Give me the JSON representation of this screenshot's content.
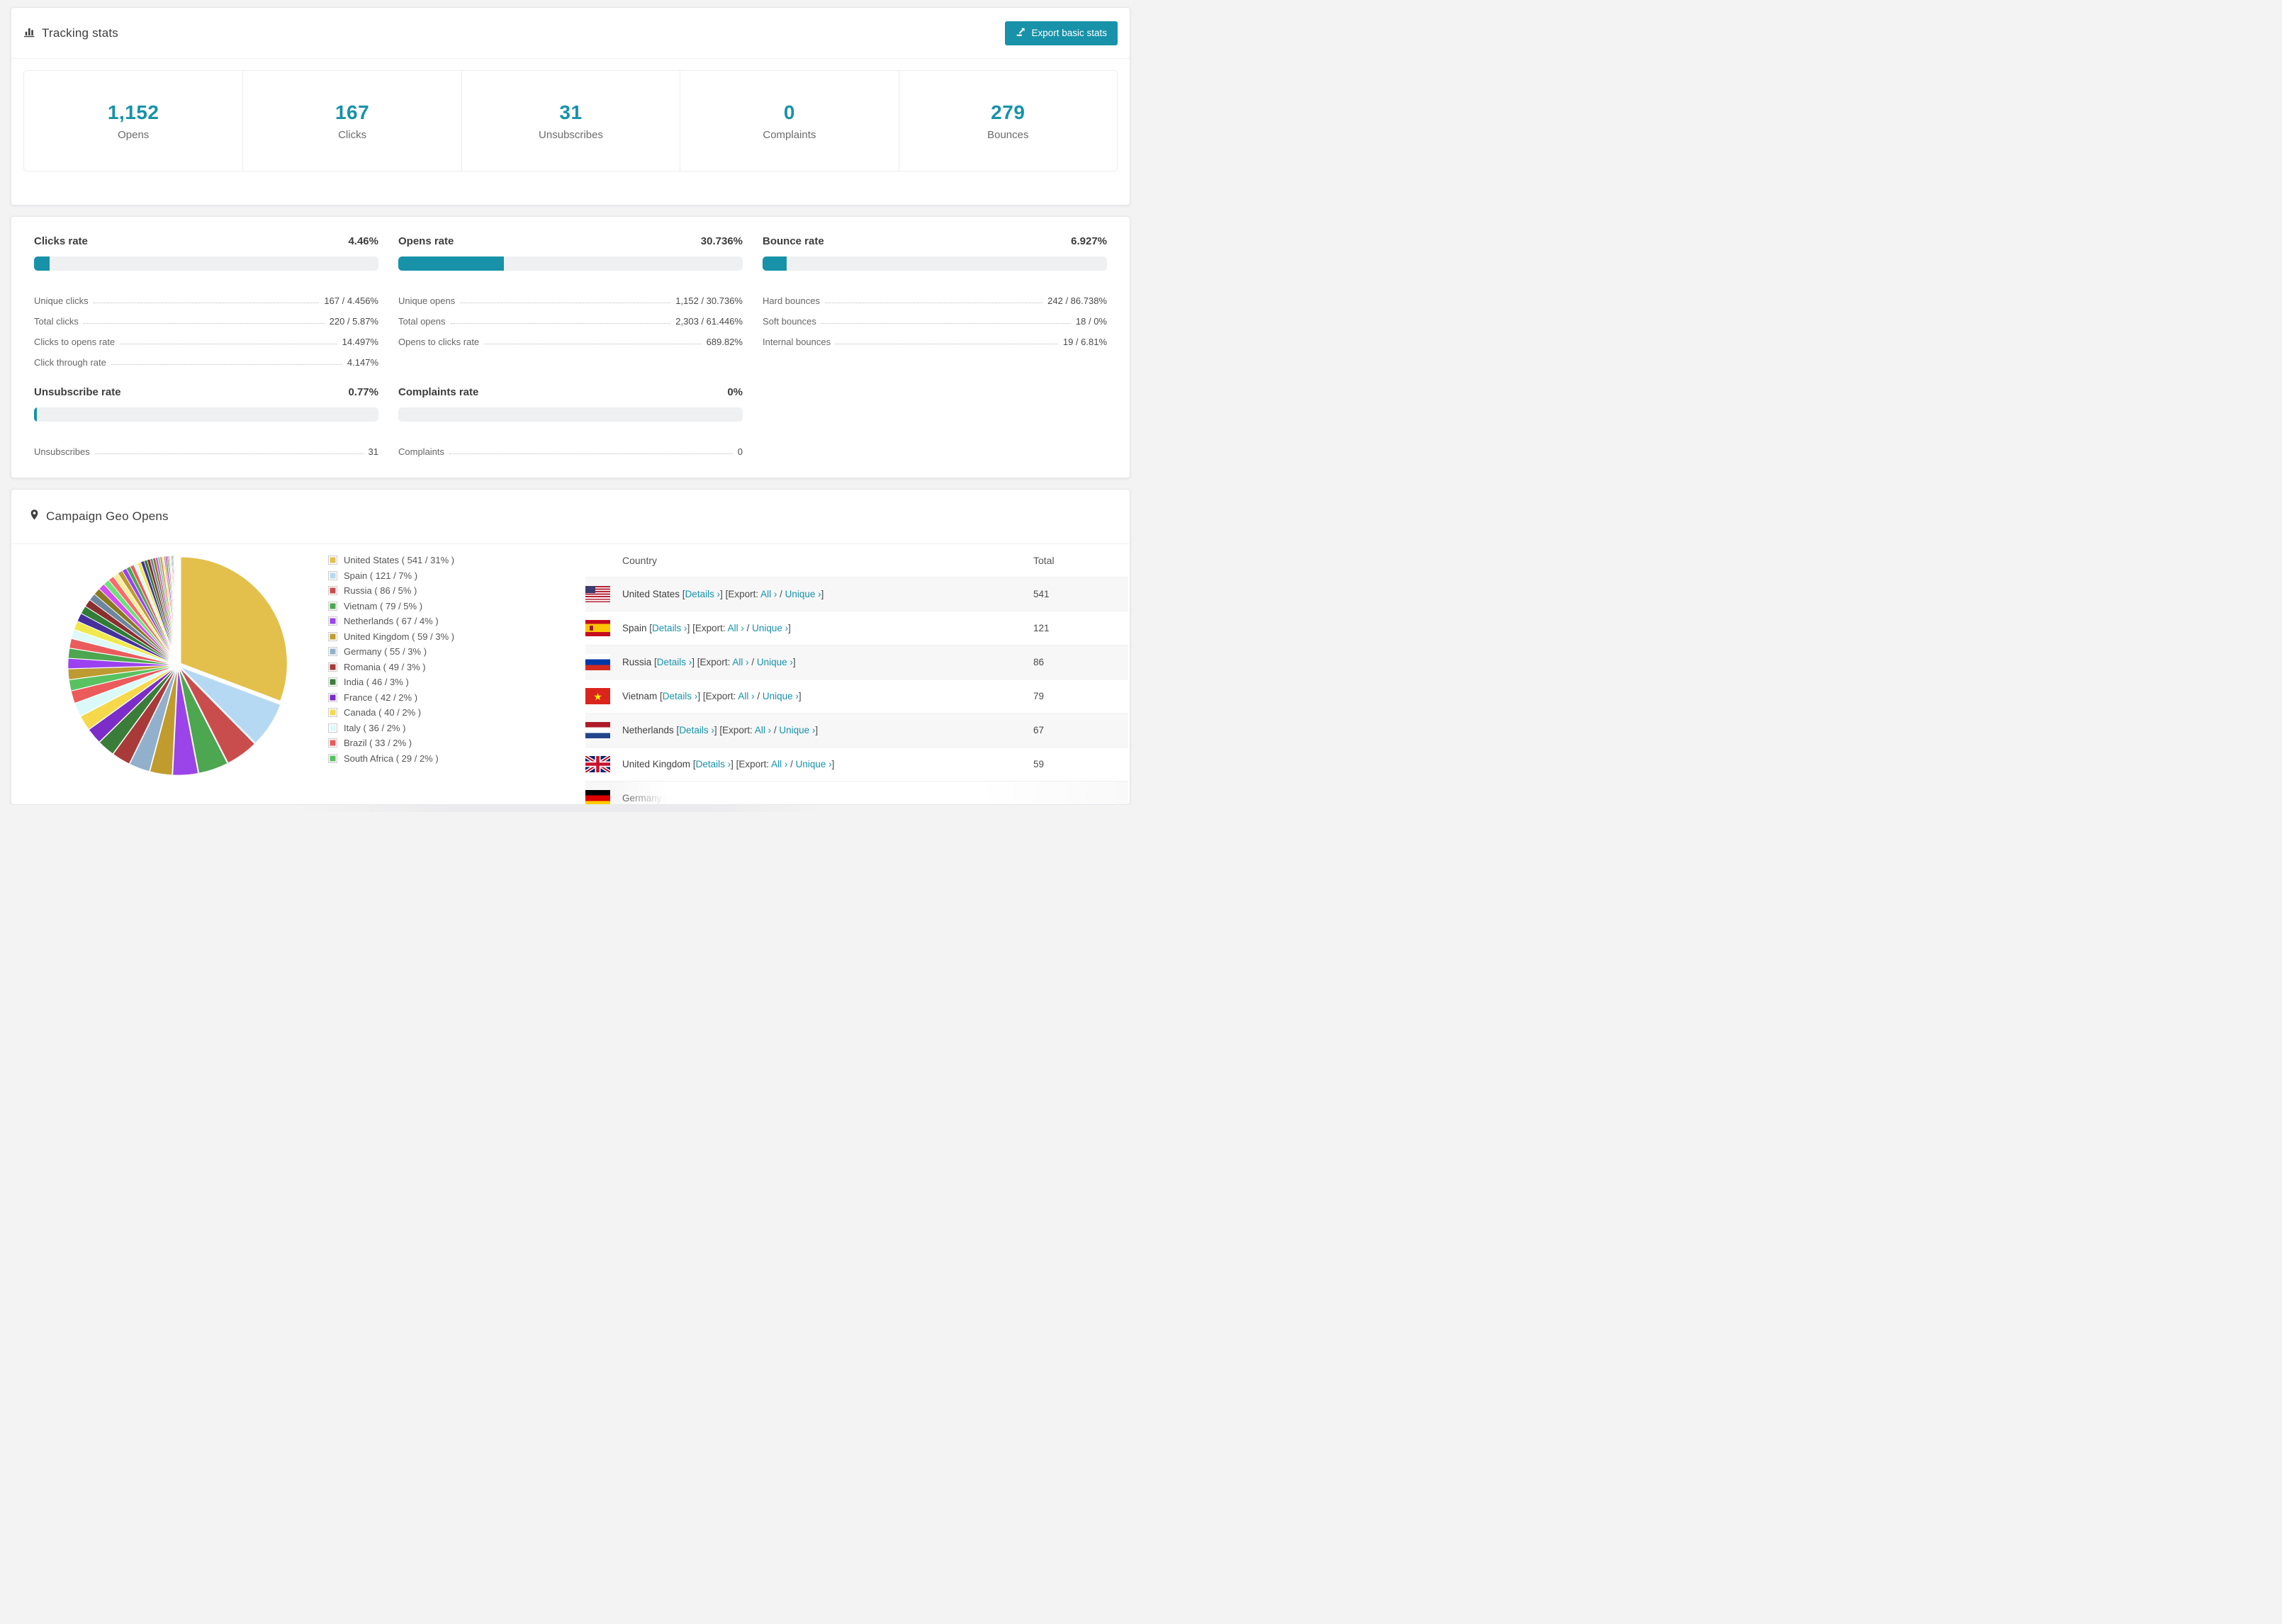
{
  "accent_color": "#1792a9",
  "header": {
    "title": "Tracking stats",
    "export_label": "Export basic stats"
  },
  "summary_stats": [
    {
      "value": "1,152",
      "label": "Opens"
    },
    {
      "value": "167",
      "label": "Clicks"
    },
    {
      "value": "31",
      "label": "Unsubscribes"
    },
    {
      "value": "0",
      "label": "Complaints"
    },
    {
      "value": "279",
      "label": "Bounces"
    }
  ],
  "rates": [
    {
      "title": "Clicks rate",
      "value": "4.46%",
      "progress_pct": 4.46,
      "rows": [
        [
          "Unique clicks",
          "167 / 4.456%"
        ],
        [
          "Total clicks",
          "220 / 5.87%"
        ],
        [
          "Clicks to opens rate",
          "14.497%"
        ],
        [
          "Click through rate",
          "4.147%"
        ]
      ]
    },
    {
      "title": "Opens rate",
      "value": "30.736%",
      "progress_pct": 30.736,
      "rows": [
        [
          "Unique opens",
          "1,152 / 30.736%"
        ],
        [
          "Total opens",
          "2,303 / 61.446%"
        ],
        [
          "Opens to clicks rate",
          "689.82%"
        ]
      ]
    },
    {
      "title": "Bounce rate",
      "value": "6.927%",
      "progress_pct": 6.927,
      "rows": [
        [
          "Hard bounces",
          "242 / 86.738%"
        ],
        [
          "Soft bounces",
          "18 / 0%"
        ],
        [
          "Internal bounces",
          "19 / 6.81%"
        ]
      ]
    },
    {
      "title": "Unsubscribe rate",
      "value": "0.77%",
      "progress_pct": 0.77,
      "rows": [
        [
          "Unsubscribes",
          "31"
        ]
      ]
    },
    {
      "title": "Complaints rate",
      "value": "0%",
      "progress_pct": 0,
      "rows": [
        [
          "Complaints",
          "0"
        ]
      ]
    }
  ],
  "geo": {
    "title": "Campaign Geo Opens",
    "legend": [
      {
        "label": "United States ( 541 / 31% )",
        "color": "#e3c04b"
      },
      {
        "label": "Spain ( 121 / 7% )",
        "color": "#b5d9f3"
      },
      {
        "label": "Russia ( 86 / 5% )",
        "color": "#ca4d4d"
      },
      {
        "label": "Vietnam ( 79 / 5% )",
        "color": "#4ca750"
      },
      {
        "label": "Netherlands ( 67 / 4% )",
        "color": "#9b44ea"
      },
      {
        "label": "United Kingdom ( 59 / 3% )",
        "color": "#c09c2e"
      },
      {
        "label": "Germany ( 55 / 3% )",
        "color": "#92b0cc"
      },
      {
        "label": "Romania ( 49 / 3% )",
        "color": "#a83a3a"
      },
      {
        "label": "India ( 46 / 3% )",
        "color": "#3a7d3a"
      },
      {
        "label": "France ( 42 / 2% )",
        "color": "#7b2cc9"
      },
      {
        "label": "Canada ( 40 / 2% )",
        "color": "#f5d94b"
      },
      {
        "label": "Italy ( 36 / 2% )",
        "color": "#dbf9f9"
      },
      {
        "label": "Brazil ( 33 / 2% )",
        "color": "#eb5b5b"
      },
      {
        "label": "South Africa ( 29 / 2% )",
        "color": "#58c261"
      }
    ],
    "table": {
      "columns": [
        "Country",
        "Total"
      ],
      "link_labels": {
        "details": "Details ›",
        "export_prefix": "Export:",
        "all": "All ›",
        "unique": "Unique ›"
      },
      "rows": [
        {
          "flag": "us",
          "country": "United States",
          "total": "541",
          "partial": false
        },
        {
          "flag": "es",
          "country": "Spain",
          "total": "121",
          "partial": false
        },
        {
          "flag": "ru",
          "country": "Russia",
          "total": "86",
          "partial": false
        },
        {
          "flag": "vn",
          "country": "Vietnam",
          "total": "79",
          "partial": false
        },
        {
          "flag": "nl",
          "country": "Netherlands",
          "total": "67",
          "partial": false
        },
        {
          "flag": "gb",
          "country": "United Kingdom",
          "total": "59",
          "partial": false
        },
        {
          "flag": "de",
          "country": "Germany",
          "total": "",
          "partial": true
        }
      ]
    }
  },
  "chart_data": {
    "type": "pie",
    "title": "Campaign Geo Opens",
    "legend_position": "right",
    "start_angle_deg": -90,
    "direction": "clockwise",
    "series": [
      {
        "name": "United States",
        "value": 541,
        "pct": "31%",
        "color": "#e3c04b"
      },
      {
        "name": "Spain",
        "value": 121,
        "pct": "7%",
        "color": "#b5d9f3"
      },
      {
        "name": "Russia",
        "value": 86,
        "pct": "5%",
        "color": "#ca4d4d"
      },
      {
        "name": "Vietnam",
        "value": 79,
        "pct": "5%",
        "color": "#4ca750"
      },
      {
        "name": "Netherlands",
        "value": 67,
        "pct": "4%",
        "color": "#9b44ea"
      },
      {
        "name": "United Kingdom",
        "value": 59,
        "pct": "3%",
        "color": "#c09c2e"
      },
      {
        "name": "Germany",
        "value": 55,
        "pct": "3%",
        "color": "#92b0cc"
      },
      {
        "name": "Romania",
        "value": 49,
        "pct": "3%",
        "color": "#a83a3a"
      },
      {
        "name": "India",
        "value": 46,
        "pct": "3%",
        "color": "#3a7d3a"
      },
      {
        "name": "France",
        "value": 42,
        "pct": "2%",
        "color": "#7b2cc9"
      },
      {
        "name": "Canada",
        "value": 40,
        "pct": "2%",
        "color": "#f5d94b"
      },
      {
        "name": "Italy",
        "value": 36,
        "pct": "2%",
        "color": "#dbf9f9"
      },
      {
        "name": "Brazil",
        "value": 33,
        "pct": "2%",
        "color": "#eb5b5b"
      },
      {
        "name": "South Africa",
        "value": 29,
        "pct": "2%",
        "color": "#58c261"
      }
    ],
    "others_estimated_values": [
      28,
      27,
      26,
      25,
      24,
      23,
      22,
      21,
      20,
      19,
      18,
      17,
      16,
      15,
      14,
      13,
      12,
      11,
      10,
      10,
      9,
      9,
      8,
      8,
      7,
      7,
      6,
      6,
      5,
      5,
      4,
      4,
      3,
      3,
      3,
      2,
      2,
      2,
      2,
      1,
      1,
      1,
      1,
      1,
      1,
      1,
      1,
      1,
      1,
      1
    ],
    "others_palette": [
      "#bd9b31",
      "#9b41f0",
      "#4ca750",
      "#eb5b5b",
      "#dff8f8",
      "#f0e94d",
      "#46309c",
      "#2f7d36",
      "#8a2f2f",
      "#6b87a0",
      "#8a7a1f",
      "#d44df0",
      "#6fe07a",
      "#fa6a6a",
      "#f5ef9e"
    ]
  }
}
